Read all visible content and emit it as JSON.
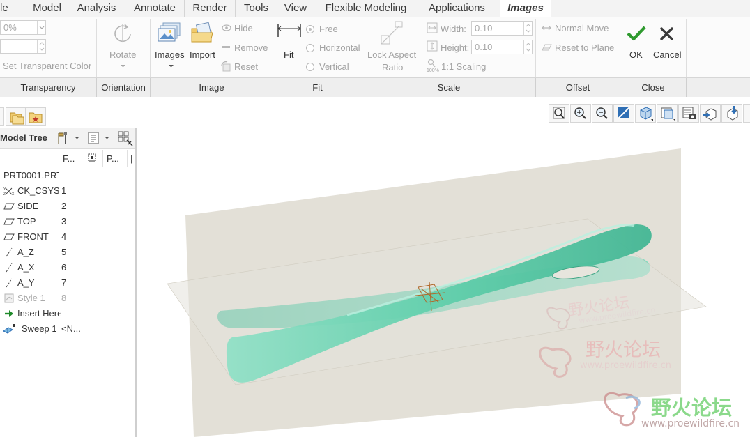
{
  "menu": {
    "tabs": [
      {
        "label": "le"
      },
      {
        "label": "Model"
      },
      {
        "label": "Analysis"
      },
      {
        "label": "Annotate"
      },
      {
        "label": "Render"
      },
      {
        "label": "Tools"
      },
      {
        "label": "View"
      },
      {
        "label": "Flexible Modeling"
      },
      {
        "label": "Applications"
      },
      {
        "label": "Images"
      }
    ]
  },
  "ribbon": {
    "transparency": {
      "value": "0%",
      "set_color_label": "Set Transparent Color",
      "group_label": "Transparency"
    },
    "orientation": {
      "rotate_label": "Rotate",
      "group_label": "Orientation"
    },
    "image": {
      "images_label": "Images",
      "import_label": "Import",
      "hide_label": "Hide",
      "remove_label": "Remove",
      "reset_label": "Reset",
      "group_label": "Image"
    },
    "fit": {
      "fit_label": "Fit",
      "free_label": "Free",
      "horizontal_label": "Horizontal",
      "vertical_label": "Vertical",
      "group_label": "Fit"
    },
    "scale": {
      "lock_line1": "Lock Aspect",
      "lock_line2": "Ratio",
      "width_label": "Width:",
      "width_value": "0.10",
      "height_label": "Height:",
      "height_value": "0.10",
      "scaling_badge": "100%",
      "scaling_label": "1:1 Scaling",
      "group_label": "Scale"
    },
    "offset": {
      "normal_move_label": "Normal Move",
      "reset_plane_label": "Reset to Plane",
      "group_label": "Offset"
    },
    "close": {
      "ok_label": "OK",
      "cancel_label": "Cancel",
      "group_label": "Close"
    }
  },
  "tree": {
    "title": "Model Tree",
    "columns": [
      "F...",
      "P..."
    ],
    "root": "PRT0001.PRT",
    "items": [
      {
        "name": "CK_CSYS",
        "num": "1"
      },
      {
        "name": "SIDE",
        "num": "2"
      },
      {
        "name": "TOP",
        "num": "3"
      },
      {
        "name": "FRONT",
        "num": "4"
      },
      {
        "name": "A_Z",
        "num": "5"
      },
      {
        "name": "A_X",
        "num": "6"
      },
      {
        "name": "A_Y",
        "num": "7"
      },
      {
        "name": "Style 1",
        "num": "8"
      },
      {
        "name": "Insert Here",
        "num": ""
      },
      {
        "name": "Sweep 1",
        "num": "<N..."
      }
    ]
  },
  "graphics": {
    "watermark_cn": "野火论坛",
    "watermark_url": "www.proewildfire.cn"
  },
  "colors": {
    "model_green": "#5fcfab",
    "plane_gray": "#ddd9cf",
    "ok_green": "#2f9a2f",
    "accent_blue": "#2f6fb5"
  }
}
